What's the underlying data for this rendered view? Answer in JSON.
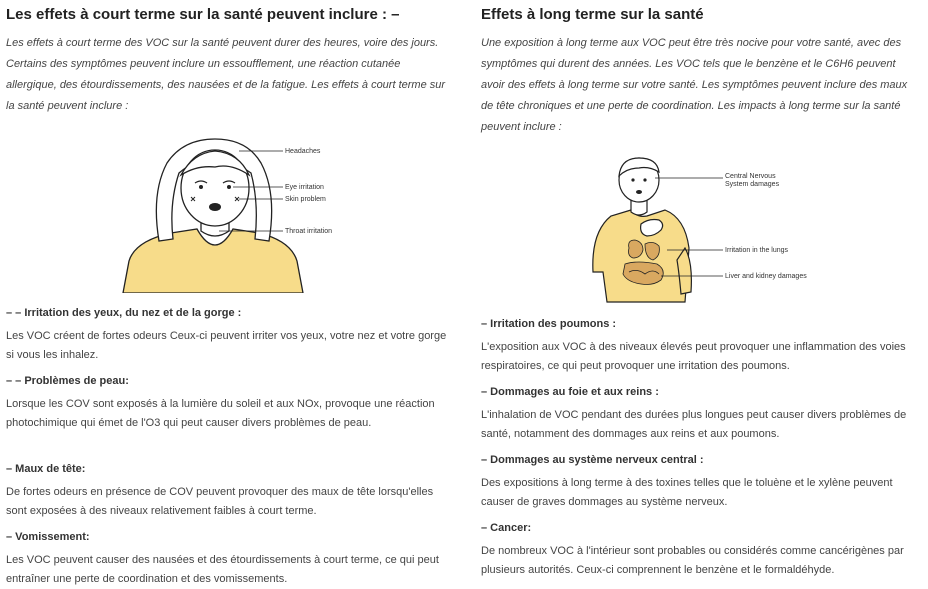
{
  "left": {
    "title": "Les effets à court terme sur la santé peuvent inclure : –",
    "intro": "Les effets à court terme des VOC sur la santé peuvent durer des heures, voire des jours. Certains des symptômes peuvent inclure un essoufflement, une réaction cutanée allergique, des étourdissements, des nausées et de la fatigue. Les effets à court terme sur la santé peuvent inclure :",
    "illustration_labels": {
      "headaches": "Headaches",
      "eye": "Eye irritation",
      "skin": "Skin problem",
      "throat": "Throat irritation"
    },
    "sections": [
      {
        "heading": "– – Irritation des yeux, du nez et de la gorge :",
        "text": "Les VOC créent de fortes odeurs Ceux-ci peuvent irriter vos yeux, votre nez et votre gorge si vous les inhalez."
      },
      {
        "heading": "– – Problèmes de peau:",
        "text": "Lorsque les COV sont exposés à la lumière du soleil et aux NOx, provoque une réaction photochimique qui émet de l'O3 qui peut causer divers problèmes de peau."
      },
      {
        "heading": "– Maux de tête:",
        "text": "De fortes odeurs en présence de COV peuvent provoquer des maux de tête lorsqu'elles sont exposées à des niveaux relativement faibles à court terme."
      },
      {
        "heading": "– Vomissement:",
        "text": "Les VOC peuvent causer des nausées et des étourdissements à court terme, ce qui peut entraîner une perte de coordination et des vomissements."
      }
    ]
  },
  "right": {
    "title": "Effets à long terme sur la santé",
    "intro": "Une exposition à long terme aux VOC peut être très nocive pour votre santé, avec des symptômes qui durent des années. Les VOC tels que le benzène et le C6H6 peuvent avoir des effets à long terme sur votre santé. Les symptômes peuvent inclure des maux de tête chroniques et une perte de coordination. Les impacts à long terme sur la santé peuvent inclure :",
    "illustration_labels": {
      "cns_line1": "Central Nervous",
      "cns_line2": "System damages",
      "lungs": "Irritation in the lungs",
      "liver": "Liver and kidney damages"
    },
    "sections": [
      {
        "heading": "– Irritation des poumons :",
        "text": "L'exposition aux VOC à des niveaux élevés peut provoquer une inflammation des voies respiratoires, ce qui peut provoquer une irritation des poumons."
      },
      {
        "heading": "– Dommages au foie et aux reins :",
        "text": "L'inhalation de VOC pendant des durées plus longues peut causer divers problèmes de santé, notamment des dommages aux reins et aux poumons."
      },
      {
        "heading": "– Dommages au système nerveux central :",
        "text": "Des expositions à long terme à des toxines telles que le toluène et le xylène peuvent causer de graves dommages au système nerveux."
      },
      {
        "heading": "– Cancer:",
        "text": "De nombreux VOC à l'intérieur sont probables ou considérés comme cancérigènes par plusieurs autorités. Ceux-ci comprennent le benzène et le formaldéhyde."
      }
    ]
  },
  "colors": {
    "shirt": "#f7dc8a",
    "organs": "#d9a860",
    "line": "#222222",
    "text": "#333333"
  }
}
